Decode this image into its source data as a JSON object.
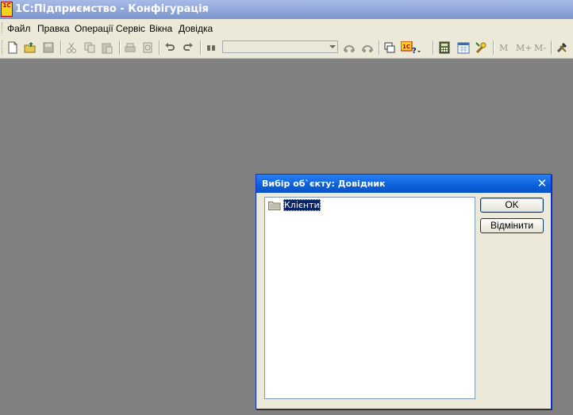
{
  "app": {
    "logo_text": "1C",
    "title": "1С:Підприємство - Конфігурація"
  },
  "menu": {
    "items": [
      {
        "label": "Файл"
      },
      {
        "label": "Правка"
      },
      {
        "label": "Операції"
      },
      {
        "label": "Сервіс"
      },
      {
        "label": "Вікна"
      },
      {
        "label": "Довідка"
      }
    ]
  },
  "toolbar": {
    "search_value": "",
    "icons": [
      "new-document-icon",
      "open-icon",
      "save-icon",
      "cut-icon",
      "copy-icon",
      "paste-icon",
      "print-icon",
      "preview-icon",
      "undo-icon",
      "redo-icon",
      "find-icon",
      "find-prev-icon",
      "find-next-icon",
      "windows-icon",
      "help-1c-icon",
      "calculator-icon",
      "calendar-icon",
      "tools-icon"
    ],
    "mem": {
      "m": "M",
      "m_plus": "M+",
      "m_minus": "M-"
    }
  },
  "dialog": {
    "title": "Вибір об`єкту: Довідник",
    "close_glyph": "✕",
    "tree_items": [
      {
        "label": "Клієнти",
        "selected": true
      }
    ],
    "ok_label": "OK",
    "cancel_label": "Відмінити"
  },
  "colors": {
    "desktop": "#808080",
    "title_blue": "#0a5fd8",
    "selection": "#0a246a"
  }
}
